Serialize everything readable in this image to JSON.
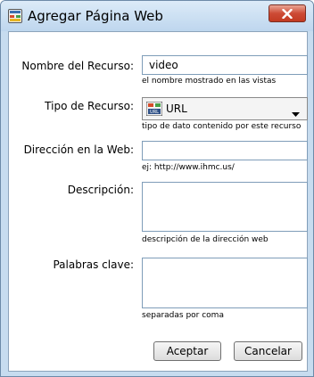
{
  "window": {
    "title": "Agregar Página Web"
  },
  "form": {
    "nombre": {
      "label": "Nombre del Recurso:",
      "value": "video",
      "hint": "el nombre mostrado en las vistas"
    },
    "tipo": {
      "label": "Tipo de Recurso:",
      "selected": "URL",
      "hint": "tipo de dato contenido por este recurso"
    },
    "direccion": {
      "label": "Dirección en la Web:",
      "value": "",
      "hint": "ej: http://www.ihmc.us/"
    },
    "descripcion": {
      "label": "Descripción:",
      "value": "",
      "hint": "descripción de la dirección web"
    },
    "palabras": {
      "label": "Palabras clave:",
      "value": "",
      "hint": "separadas por coma"
    }
  },
  "buttons": {
    "accept": "Aceptar",
    "cancel": "Cancelar"
  },
  "icons": {
    "title": "web-page-icon",
    "select": "url-icon",
    "dropdown": "chevron-down-icon",
    "close": "close-icon"
  },
  "colors": {
    "title_bar": "#c7dcef",
    "close_button": "#cd4b35",
    "field_border": "#7f9db9"
  }
}
